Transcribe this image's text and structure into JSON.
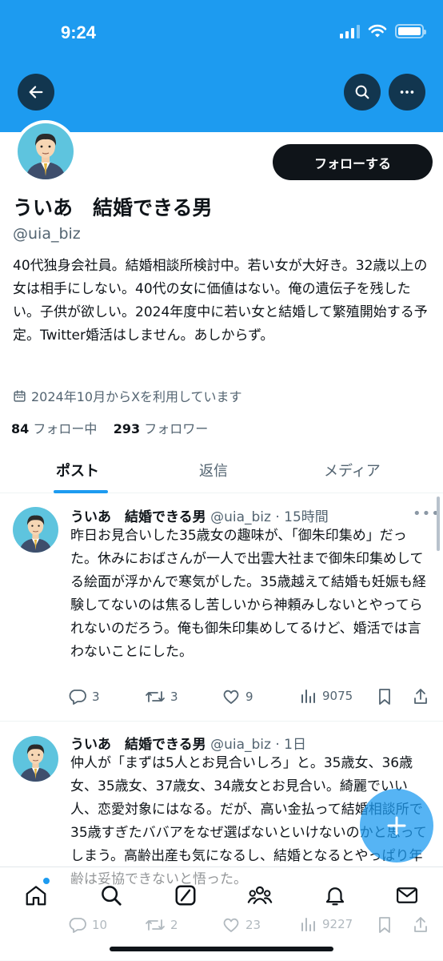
{
  "status_bar": {
    "time": "9:24"
  },
  "profile": {
    "display_name": "ういあ　結婚できる男",
    "handle": "@uia_biz",
    "follow_button": "フォローする",
    "bio": "40代独身会社員。結婚相談所検討中。若い女が大好き。32歳以上の女は相手にしない。40代の女に価値はない。俺の遺伝子を残したい。子供が欲しい。2024年度中に若い女と結婚して繁殖開始する予定。Twitter婚活はしません。あしからず。",
    "joined": "2024年10月からXを利用しています",
    "following_count": "84",
    "following_label": "フォロー中",
    "followers_count": "293",
    "followers_label": "フォロワー"
  },
  "tabs": [
    {
      "label": "ポスト",
      "active": true
    },
    {
      "label": "返信",
      "active": false
    },
    {
      "label": "メディア",
      "active": false
    }
  ],
  "posts": [
    {
      "name": "ういあ　結婚できる男",
      "meta": "@uia_biz · 15時間",
      "text": "昨日お見合いした35歳女の趣味が、「御朱印集め」だった。休みにおばさんが一人で出雲大社まで御朱印集めしてる絵面が浮かんで寒気がした。35歳越えて結婚も妊娠も経験してないのは焦るし苦しいから神頼みしないとやってられないのだろう。俺も御朱印集めしてるけど、婚活では言わないことにした。",
      "replies": "3",
      "reposts": "3",
      "likes": "9",
      "views": "9075"
    },
    {
      "name": "ういあ　結婚できる男",
      "meta": "@uia_biz · 1日",
      "text": "仲人が「まずは5人とお見合いしろ」と。35歳女、36歳女、35歳女、37歳女、34歳女とお見合い。綺麗でいい人、恋愛対象にはなる。だが、高い金払って結婚相談所で35歳すぎたババアをなぜ選ばないといけないのかと思ってしまう。高齢出産も気になるし、結婚となるとやっぱり年齢は妥協できないと悟った。",
      "replies": "10",
      "reposts": "2",
      "likes": "23",
      "views": "9227"
    }
  ],
  "icons": {
    "back": "arrow-left-icon",
    "search": "search-icon",
    "more": "more-horizontal-icon",
    "calendar": "calendar-icon",
    "reply": "reply-icon",
    "repost": "repost-icon",
    "like": "heart-icon",
    "views": "views-chart-icon",
    "bookmark": "bookmark-icon",
    "share": "share-icon",
    "compose": "compose-plus-icon",
    "nav": [
      "home-icon",
      "explore-icon",
      "grok-icon",
      "communities-icon",
      "notifications-icon",
      "messages-icon"
    ]
  },
  "colors": {
    "brand": "#1d9bf0",
    "text": "#0f1419",
    "secondary": "#536471",
    "follow_button_bg": "#0f1419"
  }
}
